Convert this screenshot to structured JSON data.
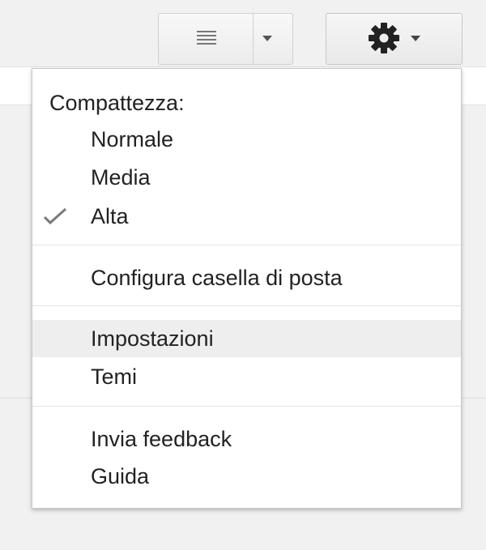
{
  "toolbar": {
    "view_icon": "lines-icon",
    "view_menu_icon": "chevron-down-icon",
    "settings_icon": "gear-icon",
    "settings_menu_icon": "chevron-down-icon"
  },
  "menu": {
    "density_heading": "Compattezza:",
    "density_options": [
      {
        "label": "Normale",
        "checked": false
      },
      {
        "label": "Media",
        "checked": false
      },
      {
        "label": "Alta",
        "checked": true
      }
    ],
    "configure_inbox": "Configura casella di posta",
    "settings": "Impostazioni",
    "themes": "Temi",
    "send_feedback": "Invia feedback",
    "help": "Guida",
    "highlighted_item": "Impostazioni"
  },
  "colors": {
    "menu_background": "#ffffff",
    "hover_background": "#eeeeee",
    "page_background": "#f1f1f1",
    "text": "#222222"
  }
}
